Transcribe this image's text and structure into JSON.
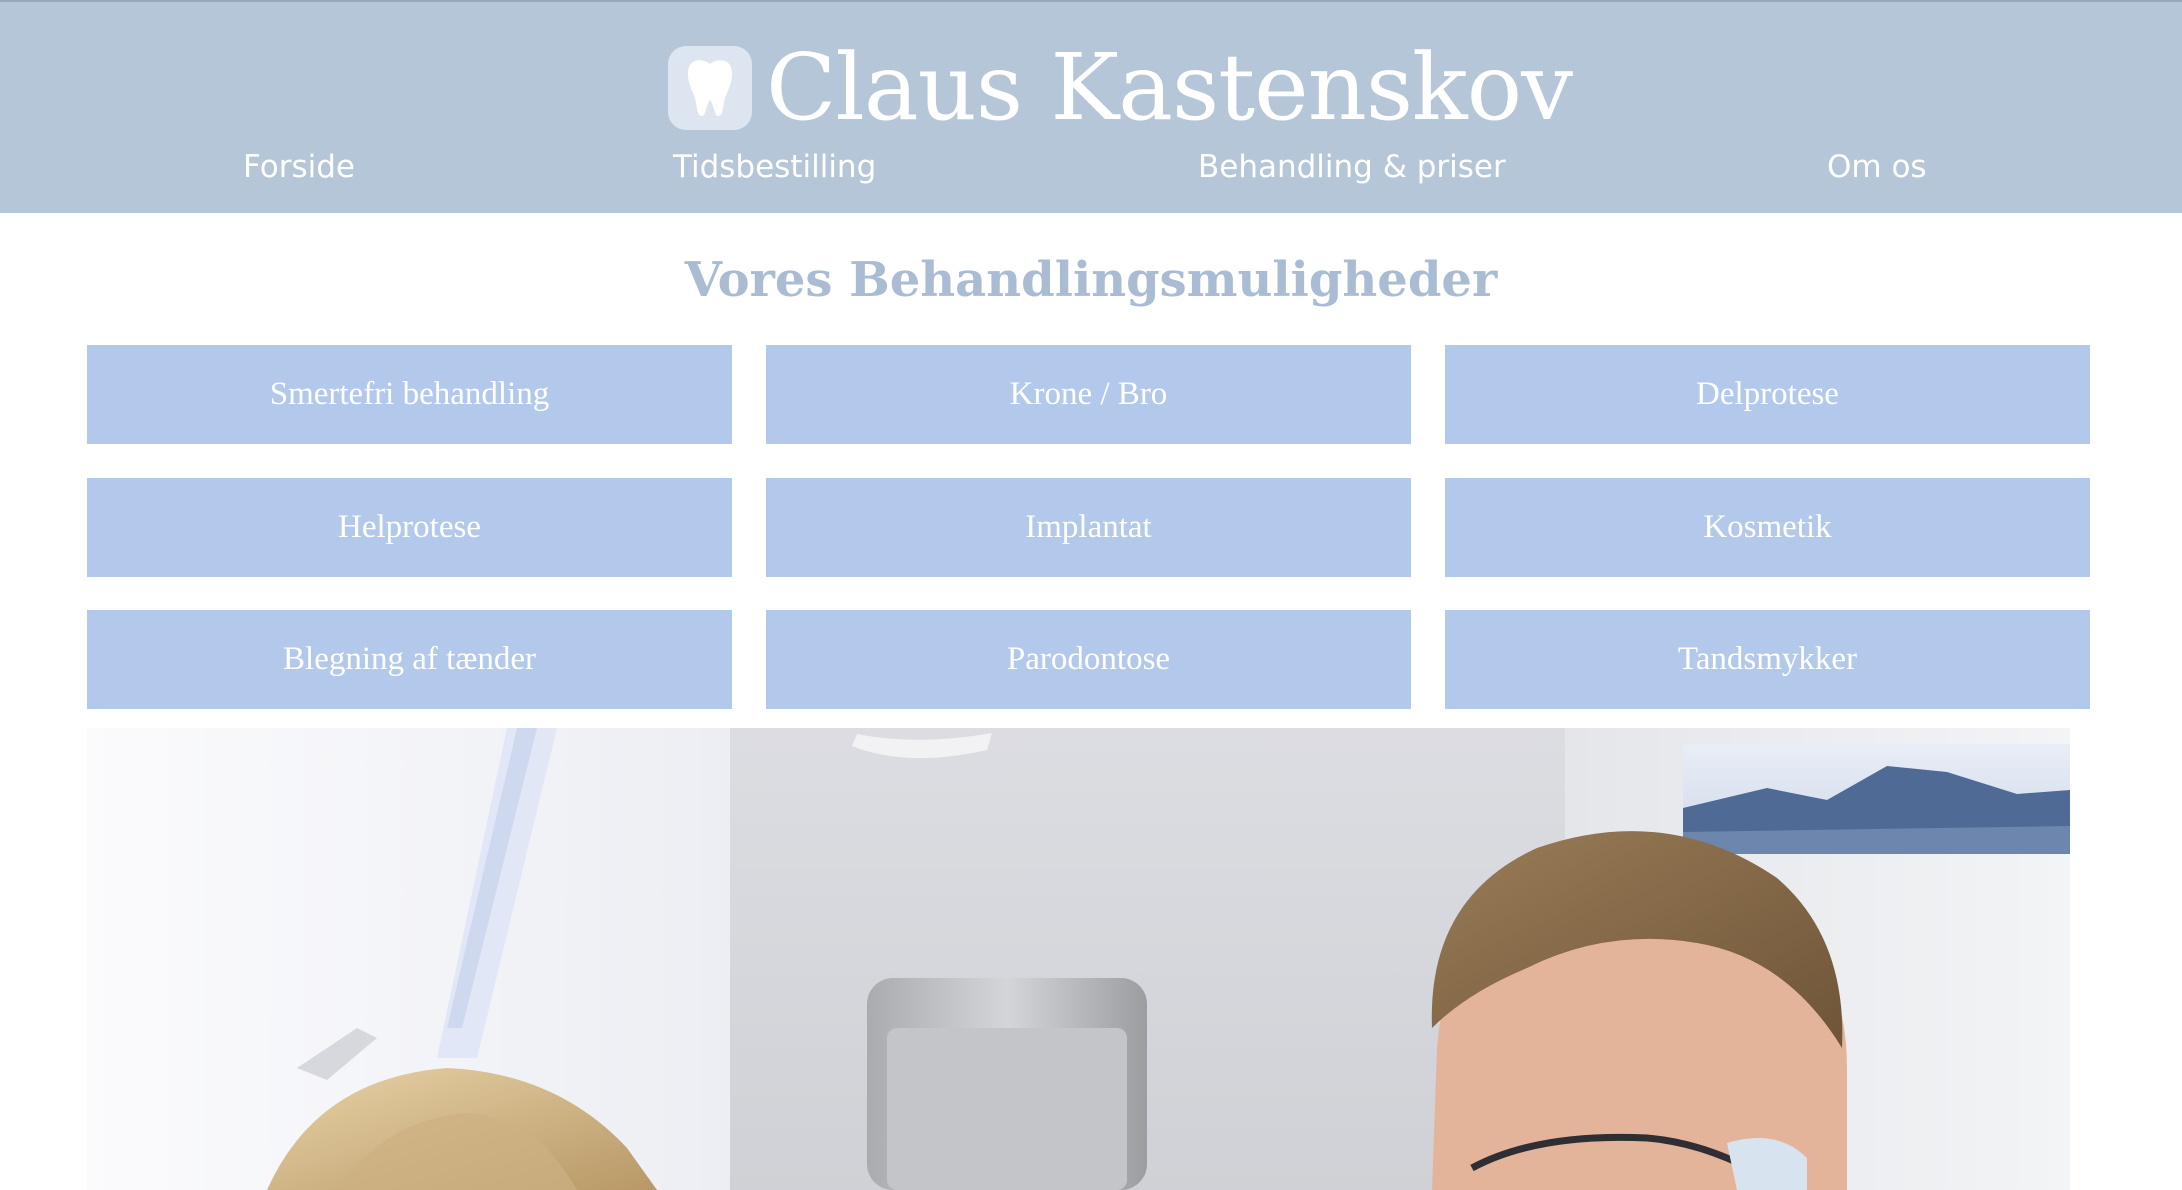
{
  "header": {
    "brand_title": "Claus Kastenskov",
    "logo_icon": "tooth-icon",
    "background_color": "#b5c6d8"
  },
  "nav": {
    "items": [
      {
        "label": "Forside"
      },
      {
        "label": "Tidsbestilling"
      },
      {
        "label": "Behandling & priser"
      },
      {
        "label": "Om os"
      }
    ]
  },
  "main": {
    "title": "Vores Behandlingsmuligheder",
    "tile_color": "#b3c9ec",
    "tiles": [
      {
        "label": "Smertefri behandling"
      },
      {
        "label": "Krone / Bro"
      },
      {
        "label": "Delprotese"
      },
      {
        "label": "Helprotese"
      },
      {
        "label": "Implantat"
      },
      {
        "label": "Kosmetik"
      },
      {
        "label": "Blegning af tænder"
      },
      {
        "label": "Parodontose"
      },
      {
        "label": "Tandsmykker"
      }
    ]
  }
}
